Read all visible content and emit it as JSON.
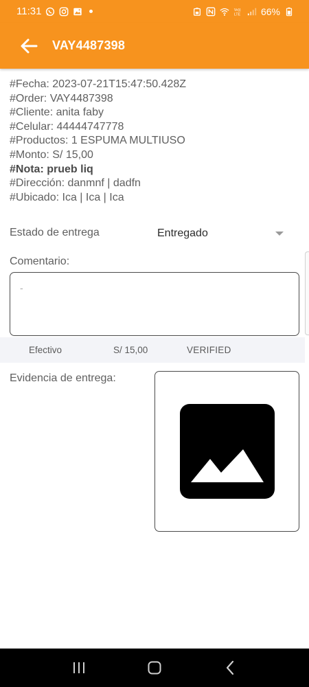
{
  "status_bar": {
    "time": "11:31",
    "battery": "66%",
    "icons_left": [
      "whatsapp-icon",
      "instagram-icon",
      "gallery-icon",
      "notification-dot"
    ],
    "icons_right": [
      "battery-saver-icon",
      "nfc-icon",
      "wifi-icon",
      "volte-icon",
      "signal-icon",
      "battery-icon"
    ]
  },
  "app_bar": {
    "title": "VAY4487398",
    "color": "#f7931e"
  },
  "details": {
    "fecha": "#Fecha: 2023-07-21T15:47:50.428Z",
    "order": "#Order: VAY4487398",
    "cliente": "#Cliente: anita faby",
    "celular": "#Celular: 44444747778",
    "productos": "#Productos: 1 ESPUMA MULTIUSO",
    "monto": "#Monto: S/ 15,00",
    "nota": "#Nota: prueb liq",
    "direccion": "#Dirección: danmnf | dadfn",
    "ubicado": "#Ubicado: Ica | Ica | Ica"
  },
  "estado": {
    "label": "Estado de entrega",
    "value": "Entregado"
  },
  "comentario": {
    "label": "Comentario:",
    "value": "-"
  },
  "payment": {
    "method": "Efectivo",
    "amount": "S/ 15,00",
    "status": "VERIFIED"
  },
  "evidencia": {
    "label": "Evidencia de entrega:",
    "icon": "image-placeholder-icon"
  },
  "nav_bar": {
    "buttons": [
      "recents-icon",
      "home-icon",
      "back-icon"
    ]
  }
}
